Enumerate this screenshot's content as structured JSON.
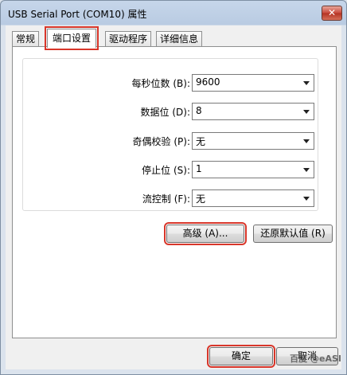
{
  "window": {
    "title": "USB Serial Port (COM10) 属性",
    "close_label": "✕"
  },
  "tabs": [
    {
      "label": "常规"
    },
    {
      "label": "端口设置"
    },
    {
      "label": "驱动程序"
    },
    {
      "label": "详细信息"
    }
  ],
  "settings": [
    {
      "label": "每秒位数 (B):",
      "value": "9600"
    },
    {
      "label": "数据位 (D):",
      "value": "8"
    },
    {
      "label": "奇偶校验 (P):",
      "value": "无"
    },
    {
      "label": "停止位 (S):",
      "value": "1"
    },
    {
      "label": "流控制 (F):",
      "value": "无"
    }
  ],
  "buttons": {
    "advanced": "高级 (A)...",
    "restore_defaults": "还原默认值 (R)",
    "ok": "确定",
    "cancel": "取消"
  },
  "watermark": "百度 @eASI"
}
